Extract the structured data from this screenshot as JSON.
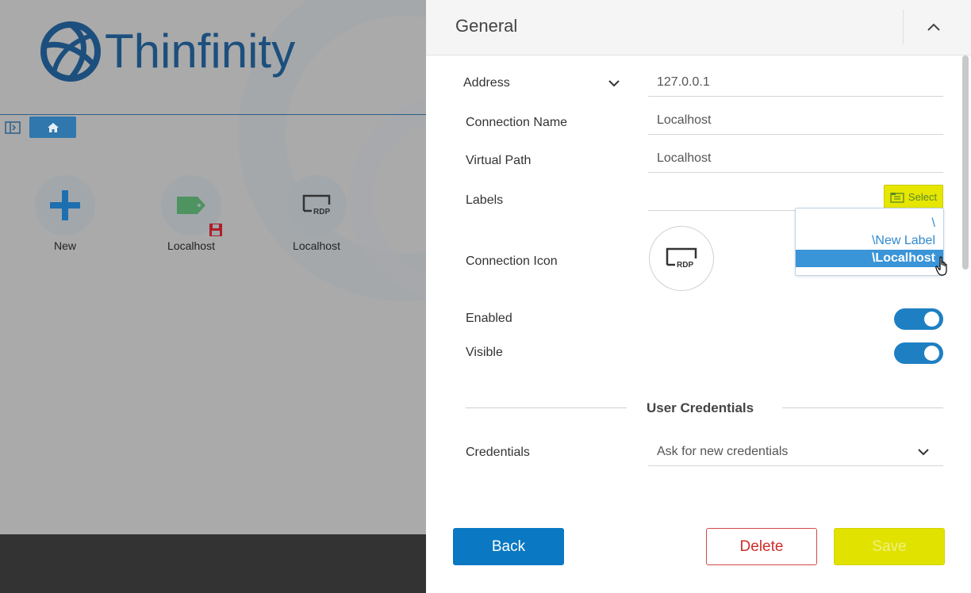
{
  "app": {
    "logo_text": "Thinfinity",
    "tiles": [
      {
        "label": "New",
        "icon": "plus-icon"
      },
      {
        "label": "Localhost",
        "icon": "tag-icon"
      },
      {
        "label": "Localhost",
        "icon": "rdp-icon"
      }
    ],
    "colors": {
      "brand": "#1c4f7d",
      "accent": "#0a78c3",
      "highlight": "#e2e200",
      "danger": "#d02c2c"
    }
  },
  "panel": {
    "title": "General",
    "fields": {
      "address_label": "Address",
      "address_value": "127.0.0.1",
      "connection_name_label": "Connection Name",
      "connection_name_value": "Localhost",
      "virtual_path_label": "Virtual Path",
      "virtual_path_value": "Localhost",
      "labels_label": "Labels",
      "select_button": "Select",
      "connection_icon_label": "Connection Icon",
      "connection_icon_text": "RDP",
      "enabled_label": "Enabled",
      "enabled": true,
      "visible_label": "Visible",
      "visible": true
    },
    "label_dropdown": {
      "items": [
        "\\",
        "\\New Label",
        "\\Localhost"
      ],
      "selected_index": 2
    },
    "credentials_section": {
      "title": "User Credentials",
      "credentials_label": "Credentials",
      "credentials_value": "Ask for new credentials"
    },
    "buttons": {
      "back": "Back",
      "delete": "Delete",
      "save": "Save"
    }
  }
}
